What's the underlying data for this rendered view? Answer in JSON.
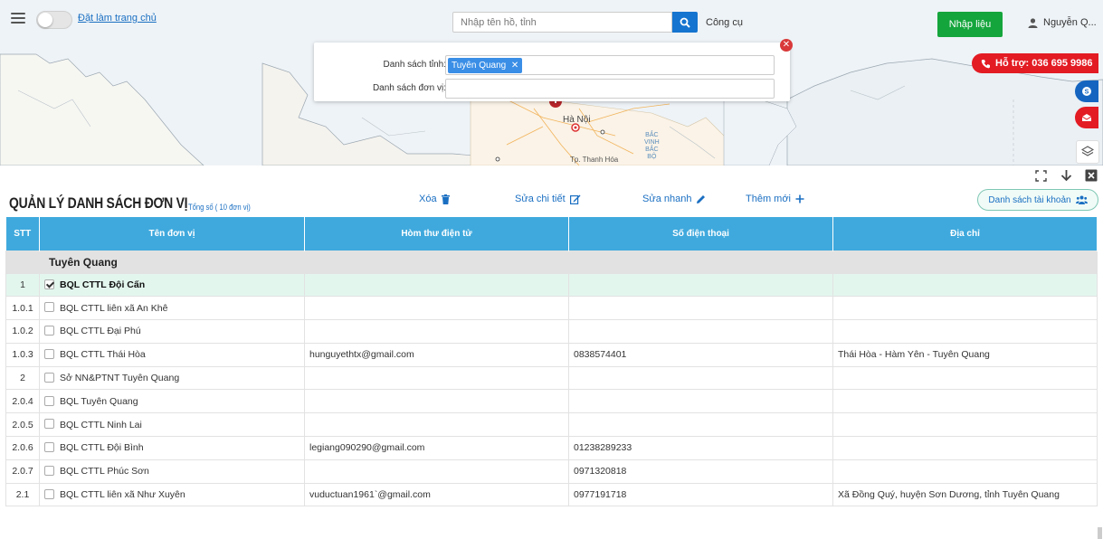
{
  "topbar": {
    "homepage_link": "Đặt làm trang chủ",
    "search_placeholder": "Nhập tên hồ, tỉnh",
    "tools_label": "Công cụ",
    "import_label": "Nhập liệu",
    "user_name": "Nguyễn Q..."
  },
  "map": {
    "city_label": "Hà Nội",
    "province_label_1": "BẮC",
    "province_label_2": "VINH",
    "province_label_3": "BẮC",
    "province_label_4": "BỘ",
    "city_label_2": "Tp. Thanh Hóa"
  },
  "support": {
    "label": "Hỗ trợ: 036 695 9986"
  },
  "filter": {
    "province_label": "Danh sách tỉnh:",
    "province_tag": "Tuyên Quang",
    "unit_label": "Danh sách đơn vị:"
  },
  "header": {
    "title": "QUẢN LÝ DANH SÁCH ĐƠN VỊ",
    "total": "Tổng số ( 10 đơn vị)",
    "delete_label": "Xóa",
    "edit_detail_label": "Sửa chi tiết",
    "quick_edit_label": "Sửa nhanh",
    "add_label": "Thêm mới",
    "account_list_label": "Danh sách tài khoản"
  },
  "table": {
    "columns": [
      "STT",
      "Tên đơn vị",
      "Hòm thư điện tử",
      "Số điện thoại",
      "Địa chỉ"
    ],
    "group": "Tuyên Quang",
    "rows": [
      {
        "stt": "1",
        "name": "BQL CTTL Đội Cấn",
        "email": "",
        "phone": "",
        "address": ""
      },
      {
        "stt": "1.0.1",
        "name": "BQL CTTL liên xã An Khê",
        "email": "",
        "phone": "",
        "address": ""
      },
      {
        "stt": "1.0.2",
        "name": "BQL CTTL Đại Phú",
        "email": "",
        "phone": "",
        "address": ""
      },
      {
        "stt": "1.0.3",
        "name": "BQL CTTL Thái Hòa",
        "email": "hunguyethtx@gmail.com",
        "phone": "0838574401",
        "address": "Thái Hòa - Hàm Yên - Tuyên Quang"
      },
      {
        "stt": "2",
        "name": "Sở NN&PTNT Tuyên Quang",
        "email": "",
        "phone": "",
        "address": ""
      },
      {
        "stt": "2.0.4",
        "name": "BQL Tuyên Quang",
        "email": "",
        "phone": "",
        "address": ""
      },
      {
        "stt": "2.0.5",
        "name": "BQL CTTL Ninh Lai",
        "email": "",
        "phone": "",
        "address": ""
      },
      {
        "stt": "2.0.6",
        "name": "BQL CTTL Đội Bình",
        "email": "legiang090290@gmail.com",
        "phone": "01238289233",
        "address": ""
      },
      {
        "stt": "2.0.7",
        "name": "BQL CTTL Phúc Sơn",
        "email": "",
        "phone": "0971320818",
        "address": ""
      },
      {
        "stt": "2.1",
        "name": "BQL CTTL liên xã Như Xuyên",
        "email": "vuductuan1961`@gmail.com",
        "phone": "0977191718",
        "address": "Xã Đồng Quý, huyện Sơn Dương, tỉnh Tuyên Quang"
      }
    ]
  },
  "colors": {
    "header_blue": "#3fa9dd",
    "accent_blue": "#1574cf",
    "green": "#14a53c",
    "red": "#e31b23",
    "selected_row": "#e3f6ee"
  },
  "icons": {
    "menu": "hamburger-icon",
    "search": "search-icon",
    "user": "user-icon",
    "phone": "phone-icon",
    "skype": "skype-icon",
    "mail": "mail-icon",
    "layers": "layers-icon",
    "fullscreen": "fullscreen-icon",
    "down": "arrow-down-icon",
    "close": "close-icon",
    "trash": "trash-icon",
    "edit": "edit-icon",
    "pencil": "pencil-icon",
    "plus": "plus-icon",
    "users": "users-icon"
  }
}
